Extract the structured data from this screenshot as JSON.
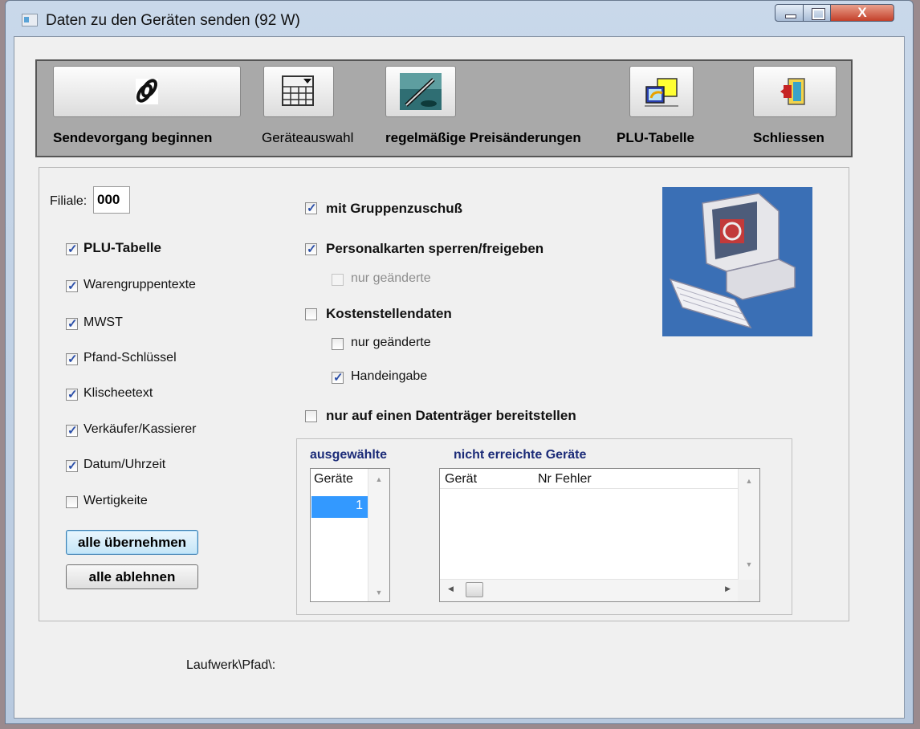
{
  "window": {
    "title": "Daten zu den Geräten senden (92 W)",
    "close_glyph": "X"
  },
  "toolbar": {
    "send_label": "Sendevorgang beginnen",
    "devices_label": "Geräteauswahl",
    "price_label": "regelmäßige Preisänderungen",
    "plu_label": "PLU-Tabelle",
    "close_label": "Schliessen"
  },
  "filiale": {
    "label": "Filiale:",
    "value": "000"
  },
  "left_options": [
    {
      "label": "PLU-Tabelle",
      "checked": true,
      "bold": true
    },
    {
      "label": "Warengruppentexte",
      "checked": true
    },
    {
      "label": "MWST",
      "checked": true
    },
    {
      "label": "Pfand-Schlüssel",
      "checked": true
    },
    {
      "label": "Klischeetext",
      "checked": true
    },
    {
      "label": "Verkäufer/Kassierer",
      "checked": true
    },
    {
      "label": "Datum/Uhrzeit",
      "checked": true
    },
    {
      "label": "Wertigkeitе",
      "checked": false
    }
  ],
  "buttons": {
    "accept_all": "alle übernehmen",
    "reject_all": "alle ablehnen"
  },
  "right_options": {
    "group_subsidy": {
      "label": "mit Gruppenzuschuß",
      "checked": true
    },
    "staff_cards": {
      "label": "Personalkarten sperren/freigeben",
      "checked": true
    },
    "staff_changed": {
      "label": "nur geänderte",
      "checked": false
    },
    "cost_centers": {
      "label": "Kostenstellendaten",
      "checked": false
    },
    "cost_changed": {
      "label": "nur geänderte",
      "checked": false
    },
    "manual_input": {
      "label": "Handeingabe",
      "checked": true
    },
    "data_carrier": {
      "label": "nur auf einen Datenträger bereitstellen",
      "checked": false
    }
  },
  "selected_list": {
    "heading": "ausgewählte",
    "column": "Geräte",
    "rows": [
      "1"
    ]
  },
  "failed_list": {
    "heading": "nicht erreichte Geräte",
    "col_device": "Gerät",
    "col_error": "Nr Fehler"
  },
  "path": {
    "label": "Laufwerk\\Pfad\\:"
  },
  "colors": {
    "selection": "#3399ff",
    "heading": "#1b2b78",
    "toolbar_bg": "#a9a9a9"
  }
}
